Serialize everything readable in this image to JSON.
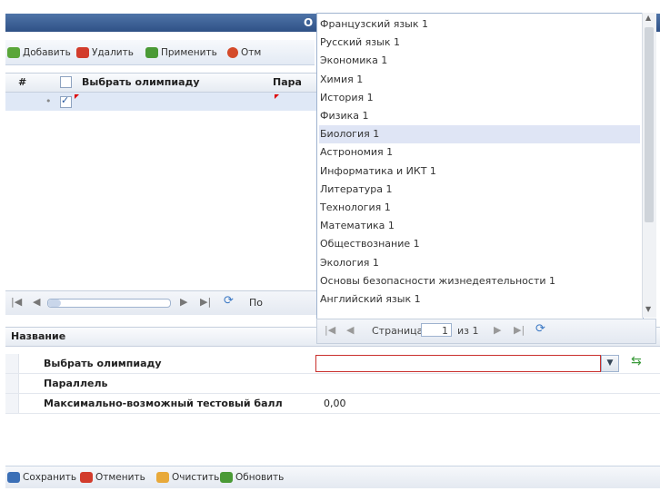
{
  "window": {
    "title": "О"
  },
  "toolbar": {
    "add_label": "Добавить",
    "delete_label": "Удалить",
    "apply_label": "Применить",
    "cancel_label": "Отм"
  },
  "grid": {
    "columns": [
      "#",
      "Выбрать олимпиаду",
      "Пара"
    ],
    "rows": [
      {
        "checked": true
      }
    ]
  },
  "grid_pager": {
    "label": "По"
  },
  "dropdown": {
    "items": [
      "Французский язык 1",
      "Русский язык 1",
      "Экономика 1",
      "Химия 1",
      "История 1",
      "Физика 1",
      "Биология 1",
      "Астрономия 1",
      "Информатика и ИКТ 1",
      "Литература 1",
      "Технология 1",
      "Математика 1",
      "Обществознание 1",
      "Экология 1",
      "Основы безопасности жизнедеятельности 1",
      "Английский язык 1"
    ],
    "selected_index": 6,
    "pager": {
      "page_label": "Страница",
      "page_value": "1",
      "of_label": "из 1"
    }
  },
  "properties": {
    "header": "Название",
    "rows": [
      {
        "label": "Выбрать олимпиаду",
        "value": ""
      },
      {
        "label": "Параллель",
        "value": ""
      },
      {
        "label": "Максимально-возможный тестовый балл",
        "value": "0,00"
      }
    ]
  },
  "bottom_bar": {
    "save_label": "Сохранить",
    "cancel_label": "Отменить",
    "clear_label": "Очистить",
    "refresh_label": "Обновить"
  },
  "colors": {
    "accent": "#2f5186",
    "selection": "#dfe5f5",
    "error": "#c9302c"
  }
}
